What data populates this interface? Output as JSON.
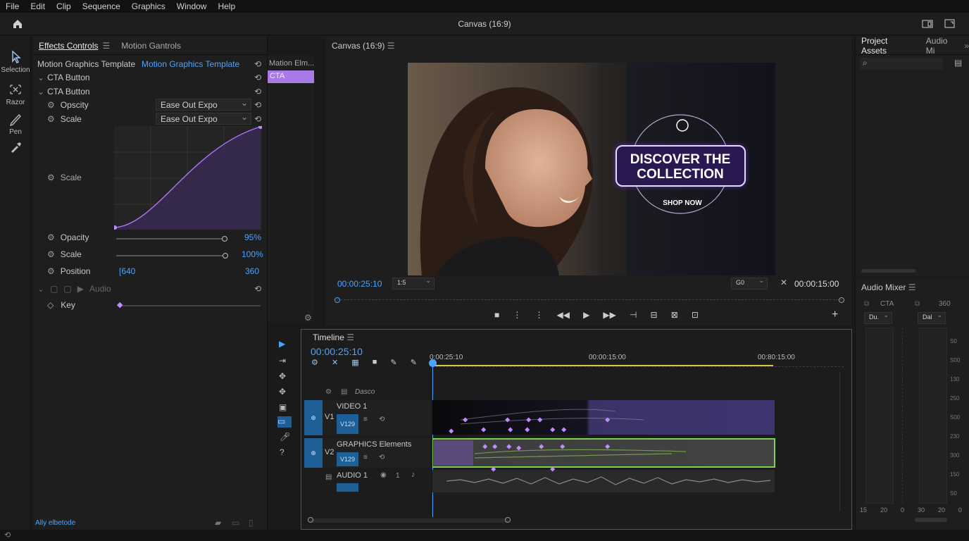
{
  "menu": [
    "File",
    "Edit",
    "Clip",
    "Sequence",
    "Graphics",
    "Window",
    "Help"
  ],
  "window_title": "Canvas (16:9)",
  "tools": [
    {
      "label": "Selection",
      "icon": "arrow-icon"
    },
    {
      "label": "Razor",
      "icon": "razor-icon"
    },
    {
      "label": "Pen",
      "icon": "pen-icon"
    },
    {
      "label": "",
      "icon": "eyedropper-icon"
    }
  ],
  "effects": {
    "tabs": [
      "Effects Controls",
      "Motion Gantrols"
    ],
    "template_label": "Motion Graphics Template",
    "template_value": "Motion Graphics Template",
    "cta1": "CTA Button",
    "cta2": "CTA Button",
    "opacity_label": "Opscity",
    "opacity_ease": "Ease Out Expo",
    "scale_label": "Scale",
    "scale_ease": "Ease Out Expo",
    "graph_label": "Scale",
    "opacity2_label": "Opacity",
    "opacity2_value": "95%",
    "opacity2_level": 0.95,
    "scale2_label": "Scale",
    "scale2_value": "100%",
    "scale2_level": 1.0,
    "position_label": "Position",
    "position_x": "[640",
    "position_y": "360",
    "audio_label": "Audio",
    "key_label": "Key",
    "mini_title": "Mation Elm...",
    "mini_clip": "CTA",
    "footer": "Ally elbetode"
  },
  "monitor": {
    "tab": "Canvas (16:9)",
    "cta_line1": "DISCOVER THE",
    "cta_line2": "COLLECTION",
    "cta_sub": "SHOP NOW",
    "timecode_left": "00:00:25:10",
    "fit_select": "1:5",
    "quality_select": "G0",
    "timecode_right": "00:00:15:00"
  },
  "assets": {
    "tabs": [
      "Project Assets",
      "Audio Mi"
    ]
  },
  "mixer": {
    "title": "Audio Mixer",
    "ch1": "CTA",
    "ch2": "360",
    "sel1": "Du.",
    "sel2": "Dal",
    "scale": [
      "S0",
      "S00",
      "130",
      "250",
      "S00",
      "230",
      "300",
      "150",
      "S0"
    ],
    "bottom": [
      "15",
      "20",
      "0",
      "30",
      "20",
      "0"
    ]
  },
  "timeline": {
    "title": "Timeline",
    "timecode": "00:00:25:10",
    "ruler": [
      "0:00:25:10",
      "00:00:15:00",
      "00:80:15:00"
    ],
    "header_row": "Dasco",
    "tracks": [
      {
        "id": "V1",
        "name": "VIDEO 1",
        "badge": "V129"
      },
      {
        "id": "V2",
        "name": "GRAPHICS Elements",
        "badge": "V129"
      },
      {
        "id": "",
        "name": "AUDIO 1",
        "badge": "",
        "extra": "1"
      }
    ]
  },
  "colors": {
    "accent": "#4aa3ff",
    "purple": "#b072ff",
    "green": "#7cd14a",
    "bg": "#1e1e1e"
  }
}
